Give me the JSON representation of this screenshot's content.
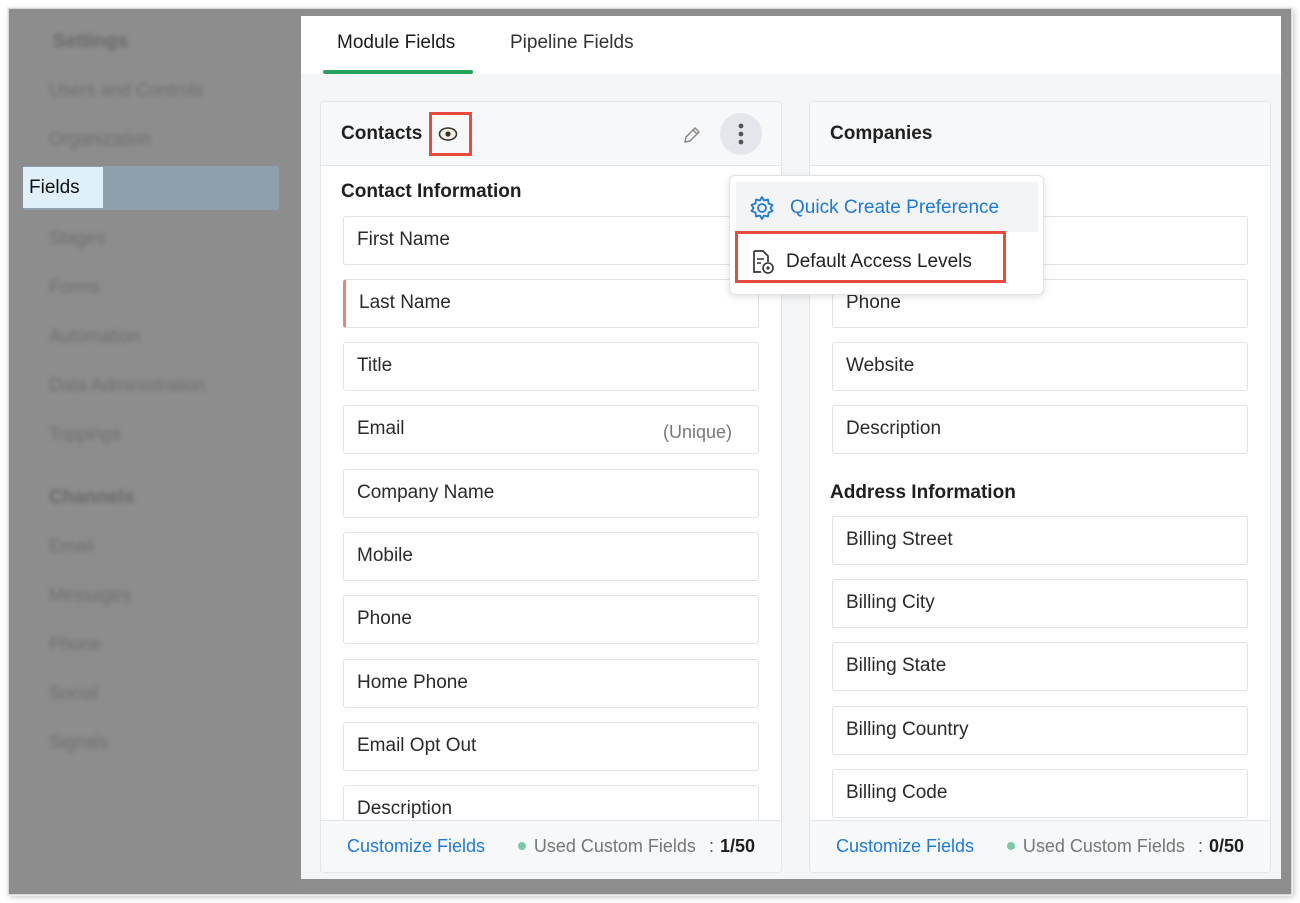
{
  "sidebar": {
    "heading_settings": "Settings",
    "items": [
      "Users and Controls",
      "Organization",
      "Fields",
      "Stages",
      "Forms",
      "Automation",
      "Data Administration",
      "Toppings"
    ],
    "heading_channels": "Channels",
    "channel_items": [
      "Email",
      "Messages",
      "Phone",
      "Social",
      "Signals"
    ],
    "active_item": "Fields"
  },
  "tabs": [
    {
      "label": "Module Fields",
      "active": true
    },
    {
      "label": "Pipeline Fields",
      "active": false
    }
  ],
  "contacts": {
    "title": "Contacts",
    "section": "Contact Information",
    "fields": [
      {
        "label": "First Name",
        "note": ""
      },
      {
        "label": "Last Name",
        "note": ""
      },
      {
        "label": "Title",
        "note": ""
      },
      {
        "label": "Email",
        "note": "(Unique)"
      },
      {
        "label": "Company Name",
        "note": ""
      },
      {
        "label": "Mobile",
        "note": ""
      },
      {
        "label": "Phone",
        "note": ""
      },
      {
        "label": "Home Phone",
        "note": ""
      },
      {
        "label": "Email Opt Out",
        "note": ""
      },
      {
        "label": "Description",
        "note": ""
      }
    ],
    "customize": "Customize Fields",
    "used_label": "Used Custom Fields",
    "used_count": "1/50"
  },
  "companies": {
    "title": "Companies",
    "fields_top": [
      "Phone",
      "Website",
      "Description"
    ],
    "address_section": "Address Information",
    "address_fields": [
      "Billing Street",
      "Billing City",
      "Billing State",
      "Billing Country",
      "Billing Code"
    ],
    "customize": "Customize Fields",
    "used_label": "Used Custom Fields",
    "used_count": "0/50"
  },
  "menu": {
    "items": [
      {
        "label": "Quick Create Preference",
        "icon": "gear-icon"
      },
      {
        "label": "Default Access Levels",
        "icon": "document-access-icon"
      }
    ]
  },
  "colors": {
    "accent": "#1e7ad6",
    "tab_underline": "#27a35e",
    "highlight": "#e84a3e",
    "mandatory": "#f0807a"
  },
  "separator": ":"
}
